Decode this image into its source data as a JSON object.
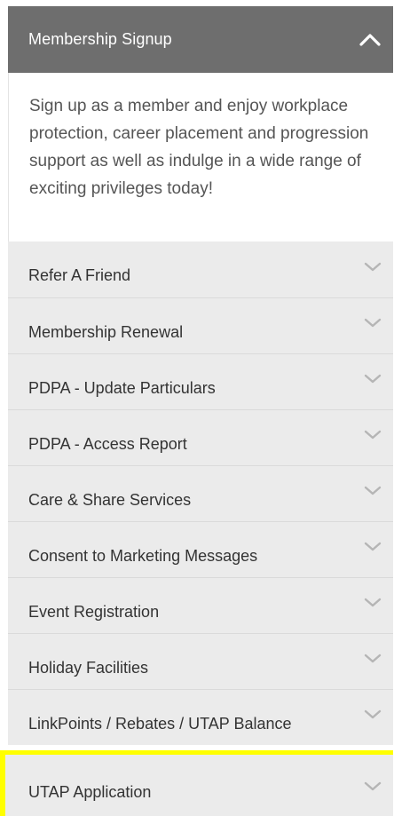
{
  "header": {
    "title": "Membership Signup",
    "icon": "chevron-up-icon"
  },
  "intro": {
    "text": "Sign up as a member and enjoy workplace protection, career placement and progression support as well as indulge in a wide range of exciting privileges today!"
  },
  "items": [
    {
      "label": "Refer A Friend",
      "icon": "chevron-down-icon"
    },
    {
      "label": "Membership Renewal",
      "icon": "chevron-down-icon"
    },
    {
      "label": "PDPA - Update Particulars",
      "icon": "chevron-down-icon"
    },
    {
      "label": "PDPA - Access Report",
      "icon": "chevron-down-icon"
    },
    {
      "label": "Care & Share Services",
      "icon": "chevron-down-icon"
    },
    {
      "label": "Consent to Marketing Messages",
      "icon": "chevron-down-icon"
    },
    {
      "label": "Event Registration",
      "icon": "chevron-down-icon"
    },
    {
      "label": "Holiday Facilities",
      "icon": "chevron-down-icon"
    },
    {
      "label": "LinkPoints / Rebates / UTAP Balance",
      "icon": "chevron-down-icon"
    },
    {
      "label": "UTAP Application",
      "icon": "chevron-down-icon"
    }
  ],
  "colors": {
    "header_bg": "#6e6e6e",
    "item_bg": "#ebebeb",
    "highlight": "#ffff00",
    "chevron": "#b5b5b5"
  }
}
